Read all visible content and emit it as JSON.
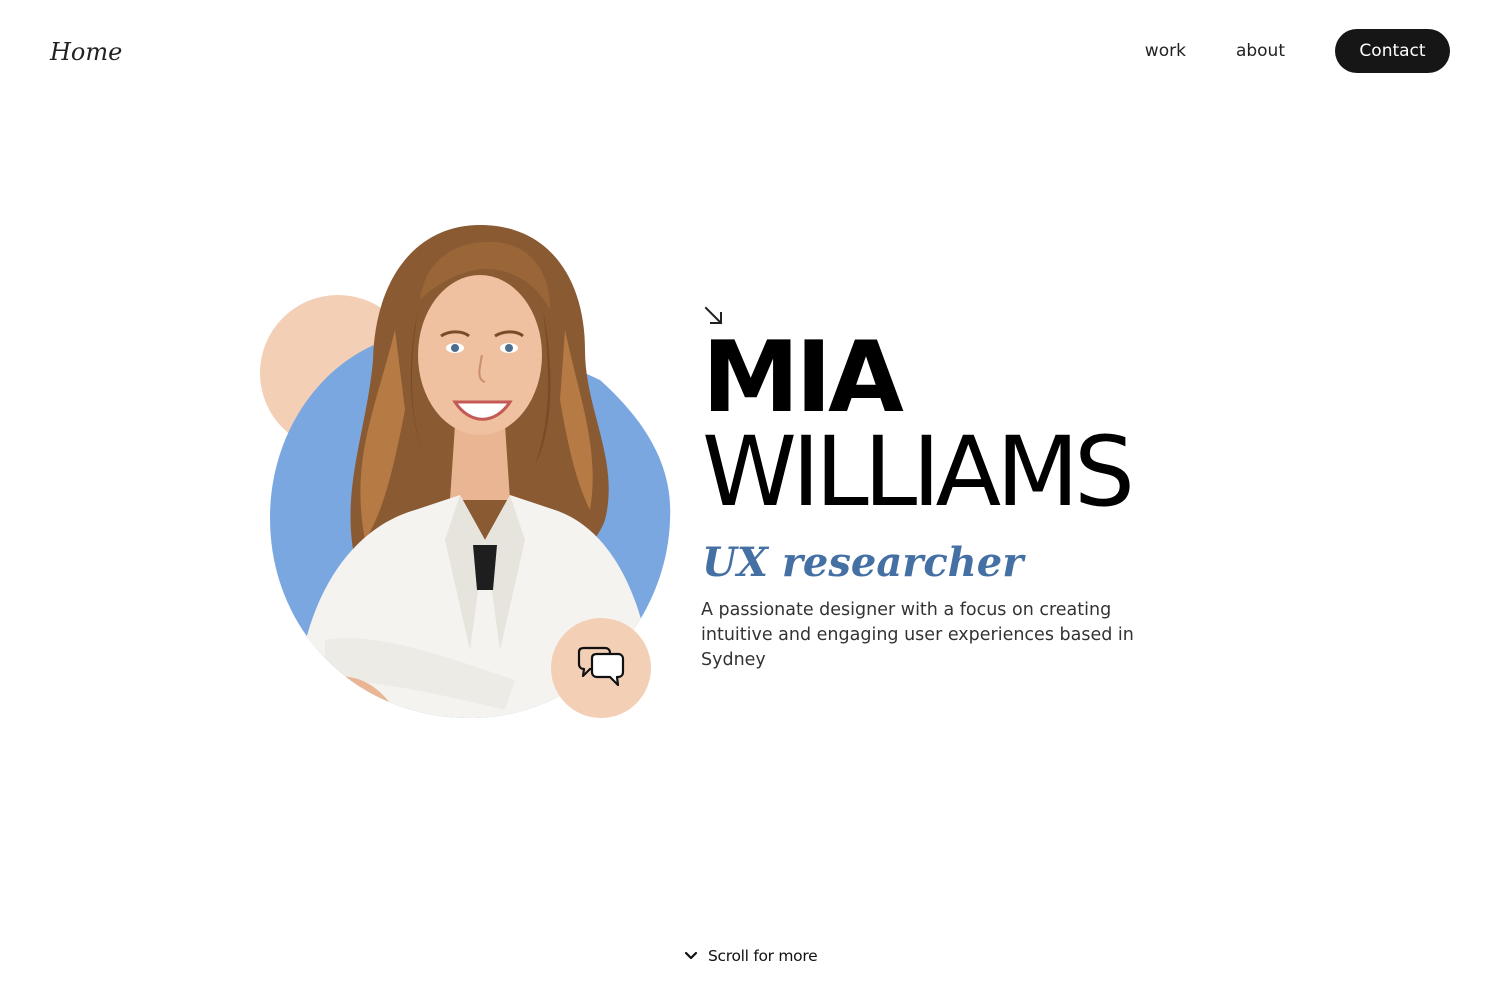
{
  "header": {
    "logo": "Home",
    "nav": [
      {
        "label": "work"
      },
      {
        "label": "about"
      }
    ],
    "contact_label": "Contact"
  },
  "hero": {
    "first_name": "MIA",
    "last_name": "WILLIAMS",
    "role": "UX researcher",
    "bio": "A passionate designer with a focus on creating intuitive and engaging user experiences based in Sydney",
    "portrait_alt": "Portrait photo",
    "icons": {
      "arrow": "arrow-down-right-icon",
      "chat": "chat-bubbles-icon",
      "chevron": "chevron-down-icon"
    }
  },
  "footer": {
    "scroll_label": "Scroll for more"
  },
  "colors": {
    "accent_blue": "#7ba7e0",
    "accent_peach": "#f3cfb6",
    "role_blue": "#4570a3",
    "button_dark": "#161616"
  }
}
